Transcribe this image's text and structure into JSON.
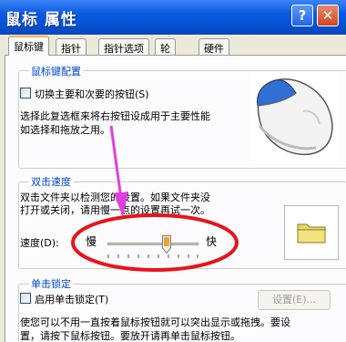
{
  "window": {
    "title": "鼠标 属性",
    "help_glyph": "?",
    "close_glyph": "✕"
  },
  "tabs": [
    {
      "label": "鼠标键",
      "active": true
    },
    {
      "label": "指针",
      "active": false
    },
    {
      "label": "指针选项",
      "active": false
    },
    {
      "label": "轮",
      "active": false
    },
    {
      "label": "硬件",
      "active": false
    }
  ],
  "button_config": {
    "legend": "鼠标键配置",
    "swap_label": "切换主要和次要的按钮(S)",
    "swap_checked": false,
    "desc_line1": "选择此复选框来将右按钮设成用于主要性能",
    "desc_line2": "如选择和拖放之用。"
  },
  "double_click": {
    "legend": "双击速度",
    "desc_line1": "双击文件夹以检测您的设置。如果文件夹没",
    "desc_line2": "打开或关闭，请用慢一点的设置再试一次。",
    "speed_label": "速度(D):",
    "slow_label": "慢",
    "fast_label": "快",
    "speed_value_fraction": 0.65
  },
  "click_lock": {
    "legend": "单击锁定",
    "enable_label": "启用单击锁定(T)",
    "enable_checked": false,
    "settings_label": "设置(E)...",
    "desc_line1": "使您可以不用一直按着鼠标按钮就可以突出显示或拖拽。要设",
    "desc_line2": "置，请按下鼠标按钮。要放开请再单击鼠标按钮。"
  },
  "annotation_colors": {
    "arrow": "#e040e0",
    "ellipse": "#e8141c"
  },
  "colors": {
    "titlebar": "#0a5ae0",
    "legend": "#0046d5",
    "mouse_button": "#2f6fd6"
  }
}
